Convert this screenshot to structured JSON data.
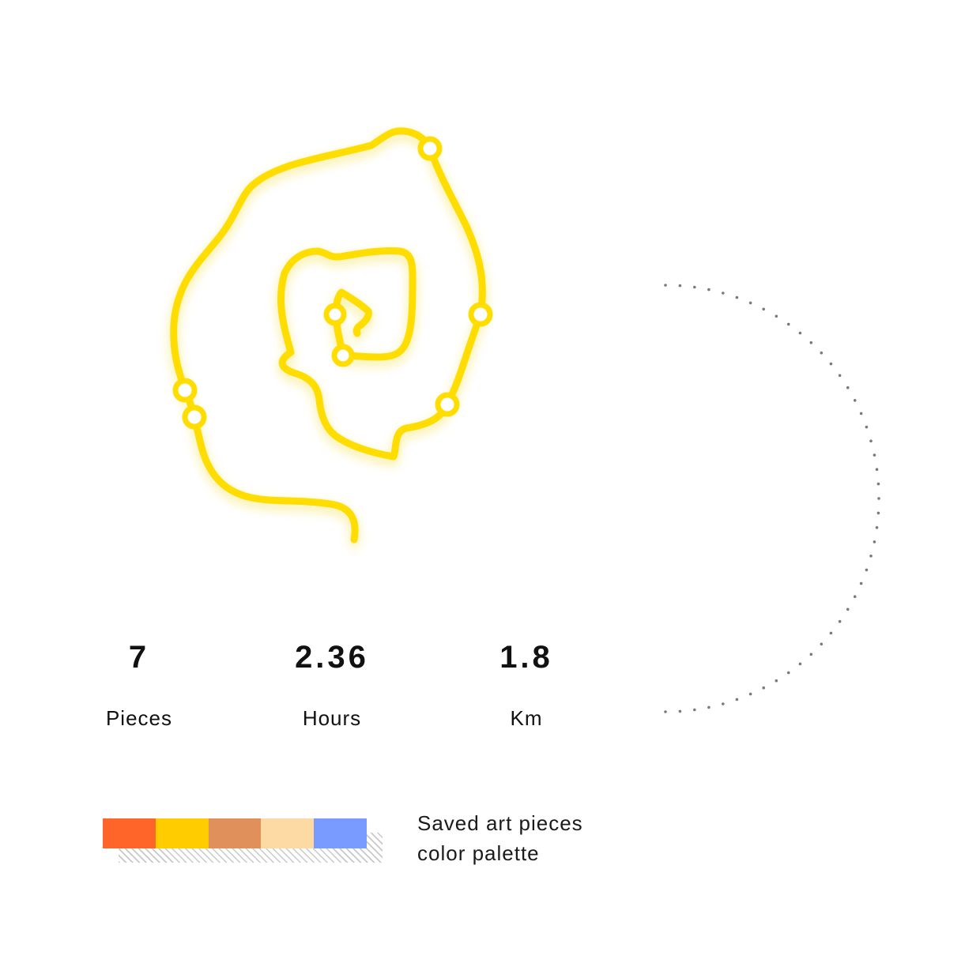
{
  "route": {
    "stroke_color": "#FFDD00",
    "glow_color": "#F2D200",
    "waypoint_count": 7
  },
  "stats": [
    {
      "value": "7",
      "label": "Pieces"
    },
    {
      "value": "2.36",
      "label": "Hours"
    },
    {
      "value": "1.8",
      "label": "Km"
    }
  ],
  "palette": {
    "caption_line1": "Saved art pieces",
    "caption_line2": "color palette",
    "swatches": [
      "#FF6528",
      "#FFCC00",
      "#E0915B",
      "#FDDAA4",
      "#799BFF"
    ]
  },
  "decoration": {
    "arc_dot_color": "#7a7a7a"
  }
}
